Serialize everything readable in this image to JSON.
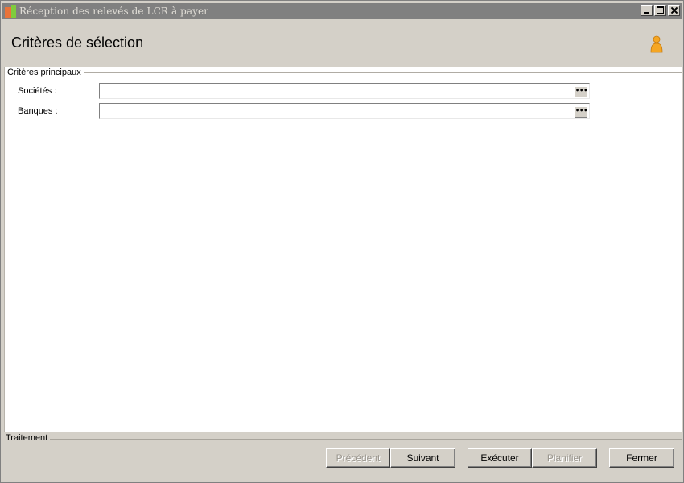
{
  "window": {
    "title": "Réception des relevés de LCR à payer",
    "controls": {
      "minimize": "minimize-icon",
      "maximize": "maximize-icon",
      "close": "close-icon"
    }
  },
  "header": {
    "title": "Critères de sélection",
    "icon": "user-icon"
  },
  "criteria": {
    "legend": "Critères principaux",
    "fields": [
      {
        "label": "Sociétés :",
        "value": "",
        "button": "•••"
      },
      {
        "label": "Banques :",
        "value": "",
        "button": "•••"
      }
    ]
  },
  "processing": {
    "legend": "Traitement",
    "buttons": {
      "previous": "Précédent",
      "next": "Suivant",
      "execute": "Exécuter",
      "schedule": "Planifier",
      "close": "Fermer"
    },
    "disabled": [
      "previous",
      "schedule"
    ]
  },
  "colors": {
    "window_bg": "#d4d0c8",
    "titlebar_bg": "#808080",
    "content_bg": "#ffffff",
    "user_icon": "#f5a623"
  }
}
